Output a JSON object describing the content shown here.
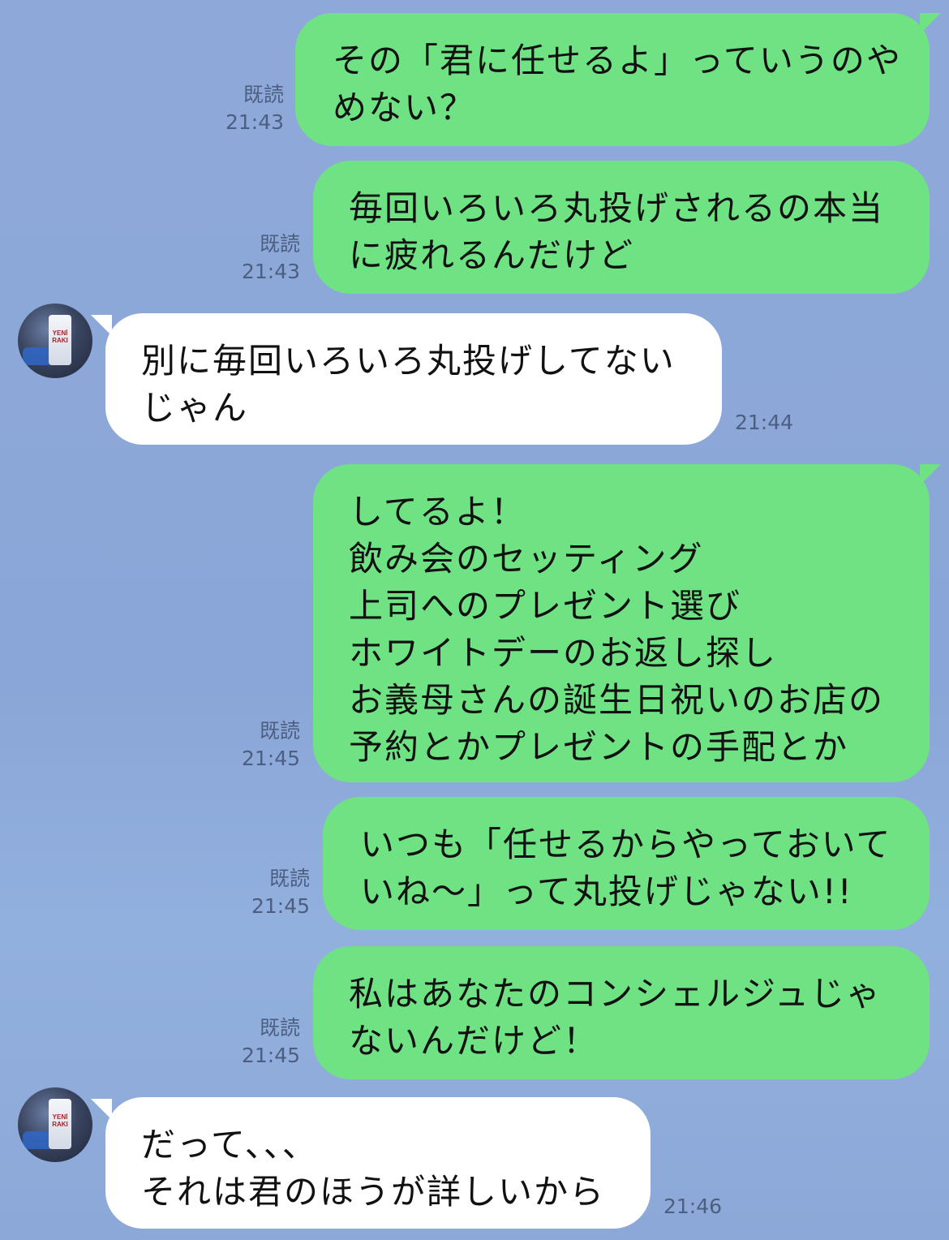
{
  "messages": [
    {
      "side": "out",
      "text": "その「君に任せるよ」っていうのや\nめない？",
      "read_label": "既読",
      "time": "21:43"
    },
    {
      "side": "out",
      "text": "毎回いろいろ丸投げされるの本当\nに疲れるんだけど",
      "read_label": "既読",
      "time": "21:43"
    },
    {
      "side": "in",
      "text": "別に毎回いろいろ丸投げしてない\nじゃん",
      "time": "21:44"
    },
    {
      "side": "out",
      "text": "してるよ！\n飲み会のセッティング\n上司へのプレゼント選び\nホワイトデーのお返し探し\nお義母さんの誕生日祝いのお店の\n予約とかプレゼントの手配とか",
      "read_label": "既読",
      "time": "21:45"
    },
    {
      "side": "out",
      "text": "いつも「任せるからやっておいて\nいね〜」って丸投げじゃない!!",
      "read_label": "既読",
      "time": "21:45"
    },
    {
      "side": "out",
      "text": "私はあなたのコンシェルジュじゃ\nないんだけど！",
      "read_label": "既読",
      "time": "21:45"
    },
    {
      "side": "in",
      "text": "だって、、、\nそれは君のほうが詳しいから",
      "time": "21:46"
    }
  ],
  "avatar": {
    "label": "YENİ RAKI"
  },
  "colors": {
    "background": "#8ea9d9",
    "outgoing_bubble": "#6fe283",
    "incoming_bubble": "#ffffff",
    "meta_text": "#4c5f80"
  }
}
